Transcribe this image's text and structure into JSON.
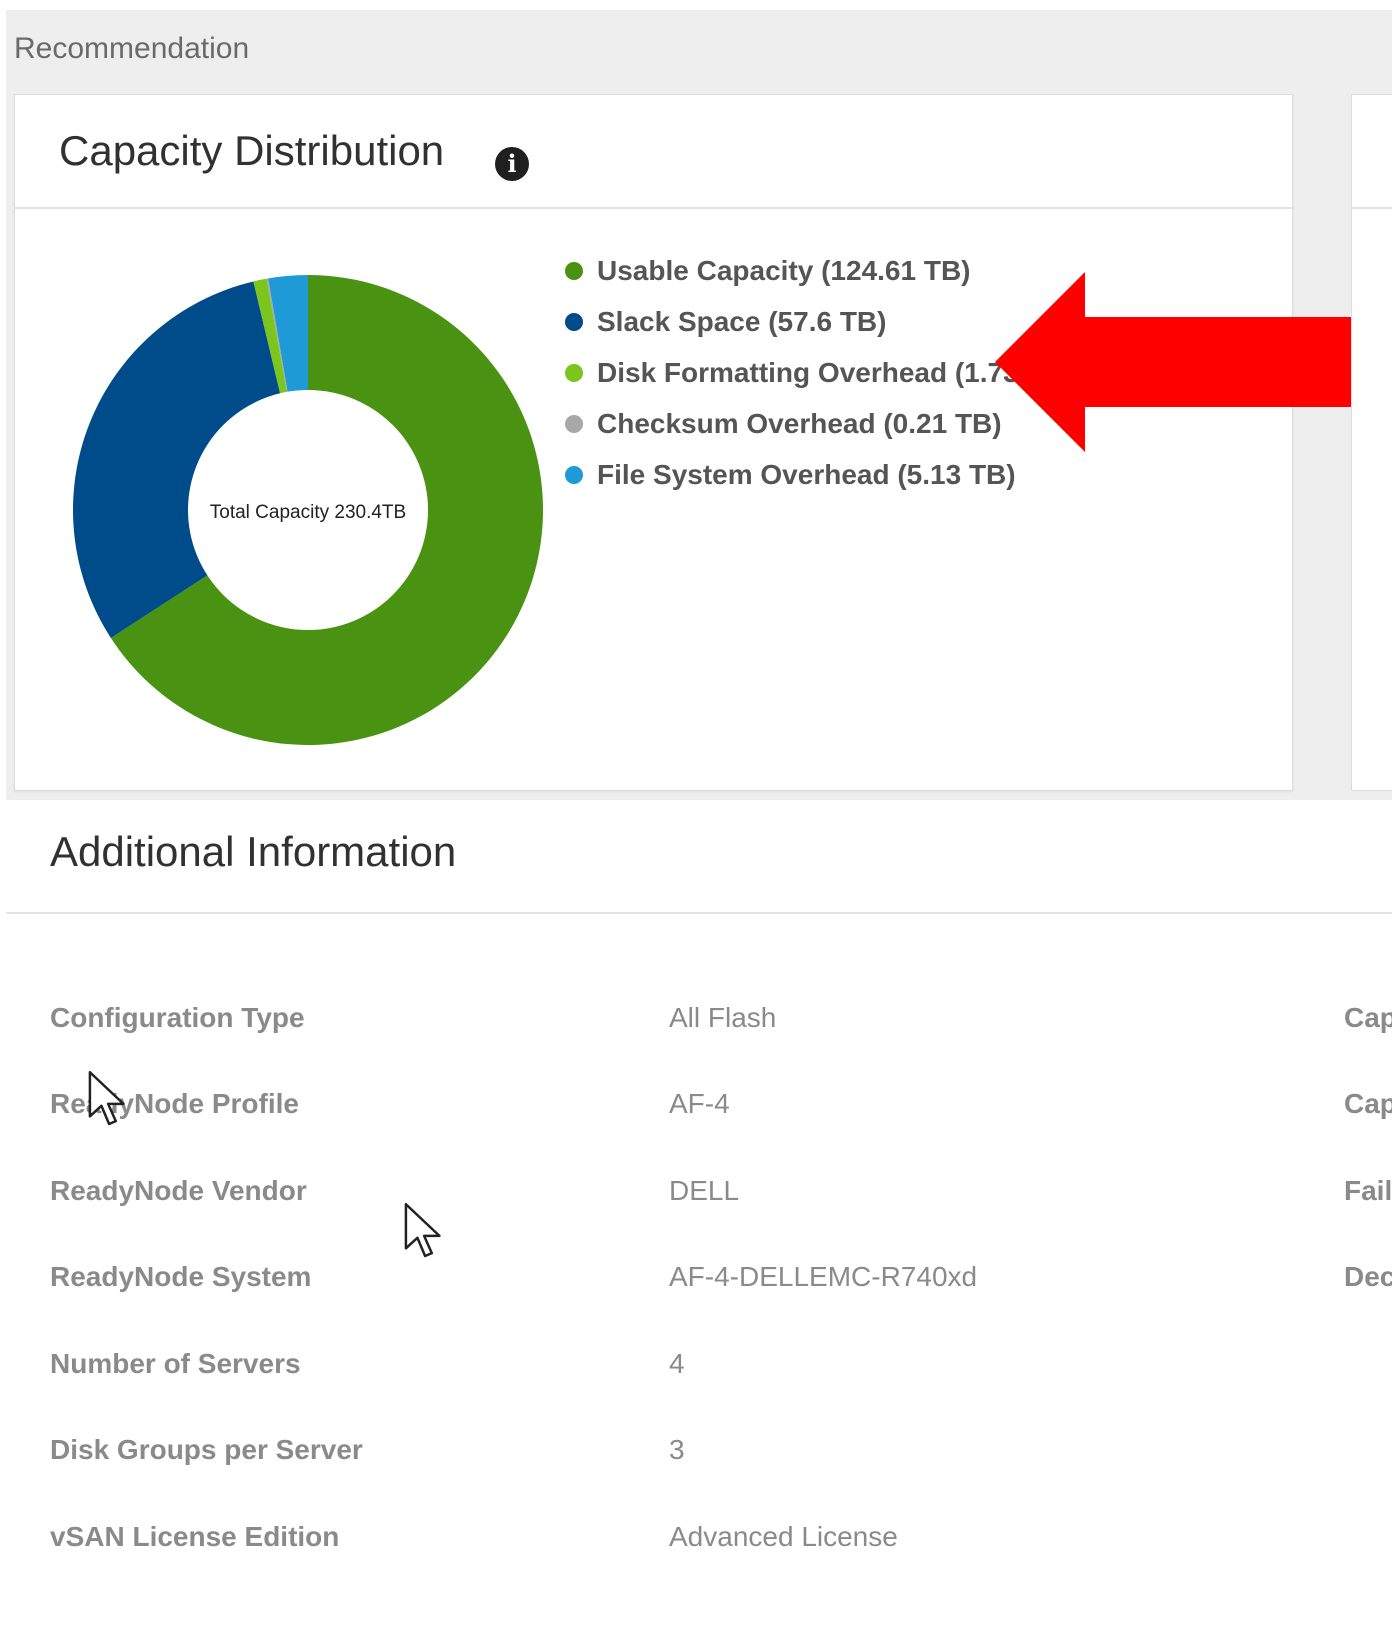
{
  "section": {
    "label": "Recommendation"
  },
  "capacity_card": {
    "title": "Capacity Distribution",
    "center_label": "Total Capacity 230.4TB",
    "legend": [
      {
        "label": "Usable Capacity (124.61 TB)",
        "color": "#4a9212"
      },
      {
        "label": "Slack Space (57.6 TB)",
        "color": "#004c8a"
      },
      {
        "label": "Disk Formatting Overhead (1.73 TB)",
        "color": "#7cc51d"
      },
      {
        "label": "Checksum Overhead (0.21 TB)",
        "color": "#a8a8a8"
      },
      {
        "label": "File System Overhead (5.13 TB)",
        "color": "#1e9bd7"
      }
    ]
  },
  "chart_data": {
    "type": "pie",
    "categories": [
      "Usable Capacity",
      "Slack Space",
      "Disk Formatting Overhead",
      "Checksum Overhead",
      "File System Overhead"
    ],
    "values": [
      124.61,
      57.6,
      1.73,
      0.21,
      5.13
    ],
    "colors": [
      "#4a9212",
      "#004c8a",
      "#7cc51d",
      "#a8a8a8",
      "#1e9bd7"
    ],
    "title": "Capacity Distribution",
    "legend_position": "right"
  },
  "additional_info": {
    "title": "Additional Information",
    "rows": [
      {
        "label": "Configuration Type",
        "value": "All Flash",
        "right": "Cap"
      },
      {
        "label": "ReadyNode Profile",
        "value": "AF-4",
        "right": "Cap"
      },
      {
        "label": "ReadyNode Vendor",
        "value": "DELL",
        "right": "Fail"
      },
      {
        "label": "ReadyNode System",
        "value": "AF-4-DELLEMC-R740xd",
        "right": "Dec"
      },
      {
        "label": "Number of Servers",
        "value": "4",
        "right": ""
      },
      {
        "label": "Disk Groups per Server",
        "value": "3",
        "right": ""
      },
      {
        "label": "vSAN License Edition",
        "value": "Advanced License",
        "right": ""
      }
    ]
  },
  "annotation": {
    "arrow_color": "#ff0000"
  }
}
